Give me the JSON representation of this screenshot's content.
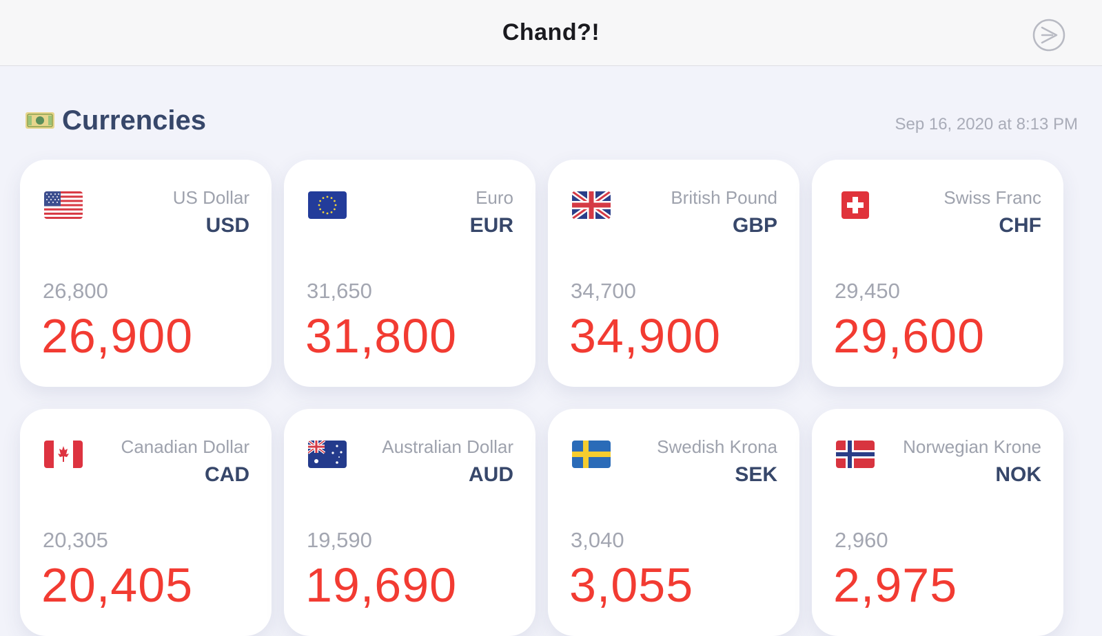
{
  "app": {
    "title": "Chand?!"
  },
  "section": {
    "title": "Currencies",
    "icon": "banknote-icon",
    "timestamp": "Sep 16, 2020 at 8:13 PM"
  },
  "colors": {
    "sell_price": "#f23b32",
    "buy_price": "#a3a6b1",
    "currency_code": "#37476a",
    "background": "#f2f3fa",
    "card": "#ffffff"
  },
  "currencies": [
    {
      "name": "US Dollar",
      "code": "USD",
      "buy": "26,800",
      "sell": "26,900",
      "flag": "us-flag-icon"
    },
    {
      "name": "Euro",
      "code": "EUR",
      "buy": "31,650",
      "sell": "31,800",
      "flag": "eu-flag-icon"
    },
    {
      "name": "British Pound",
      "code": "GBP",
      "buy": "34,700",
      "sell": "34,900",
      "flag": "uk-flag-icon"
    },
    {
      "name": "Swiss Franc",
      "code": "CHF",
      "buy": "29,450",
      "sell": "29,600",
      "flag": "swiss-flag-icon"
    },
    {
      "name": "Canadian Dollar",
      "code": "CAD",
      "buy": "20,305",
      "sell": "20,405",
      "flag": "canada-flag-icon"
    },
    {
      "name": "Australian Dollar",
      "code": "AUD",
      "buy": "19,590",
      "sell": "19,690",
      "flag": "australia-flag-icon"
    },
    {
      "name": "Swedish Krona",
      "code": "SEK",
      "buy": "3,040",
      "sell": "3,055",
      "flag": "sweden-flag-icon"
    },
    {
      "name": "Norwegian Krone",
      "code": "NOK",
      "buy": "2,960",
      "sell": "2,975",
      "flag": "norway-flag-icon"
    }
  ]
}
